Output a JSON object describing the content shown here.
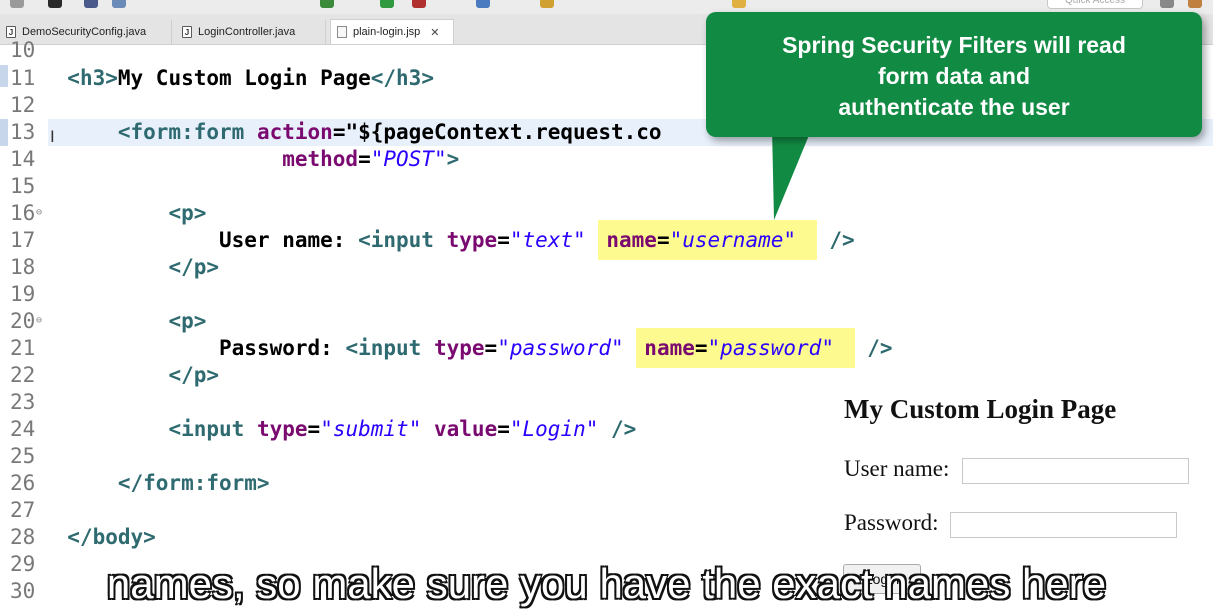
{
  "toolbar": {
    "quick_access_placeholder": "Quick Access"
  },
  "tabs": [
    {
      "label": "DemoSecurityConfig.java",
      "icon": "java-file-icon"
    },
    {
      "label": "LoginController.java",
      "icon": "java-file-icon"
    },
    {
      "label": "plain-login.jsp",
      "icon": "jsp-file-icon",
      "active": true
    }
  ],
  "editor": {
    "lines": [
      {
        "n": "10"
      },
      {
        "n": "11"
      },
      {
        "n": "12"
      },
      {
        "n": "13"
      },
      {
        "n": "14"
      },
      {
        "n": "15"
      },
      {
        "n": "16"
      },
      {
        "n": "17"
      },
      {
        "n": "18"
      },
      {
        "n": "19"
      },
      {
        "n": "20"
      },
      {
        "n": "21"
      },
      {
        "n": "22"
      },
      {
        "n": "23"
      },
      {
        "n": "24"
      },
      {
        "n": "25"
      },
      {
        "n": "26"
      },
      {
        "n": "27"
      },
      {
        "n": "28"
      },
      {
        "n": "29"
      },
      {
        "n": "30"
      }
    ],
    "code": {
      "h3_open": "<h3>",
      "h3_text": "My Custom Login Page",
      "h3_close": "</h3>",
      "form_open": "<form:form",
      "action_attr": "action",
      "action_val": "\"${pageContext.request.co",
      "method_attr": "method",
      "method_val": "\"POST\"",
      "tag_end": ">",
      "p_open": "<p>",
      "p_close": "</p>",
      "username_label": "User name: ",
      "password_label": "Password: ",
      "input_open": "<input ",
      "type_attr": "type",
      "type_text": "\"text\"",
      "type_password": "\"password\"",
      "name_attr": "name",
      "name_username": "\"username\"",
      "name_password": "\"password\"",
      "self_close": " />",
      "type_submit": "\"submit\"",
      "value_attr": "value",
      "value_login": "\"Login\"",
      "form_close": "</form:form>",
      "body_close": "</body>",
      "eq": "="
    }
  },
  "callout": {
    "lines": [
      "Spring Security Filters will read",
      "form data and",
      "authenticate the user"
    ],
    "color": "#118a43"
  },
  "preview": {
    "title": "My Custom Login Page",
    "username_label": "User name:",
    "password_label": "Password:",
    "login_button": "Login"
  },
  "subtitle": "names, so make sure you have the exact names here"
}
